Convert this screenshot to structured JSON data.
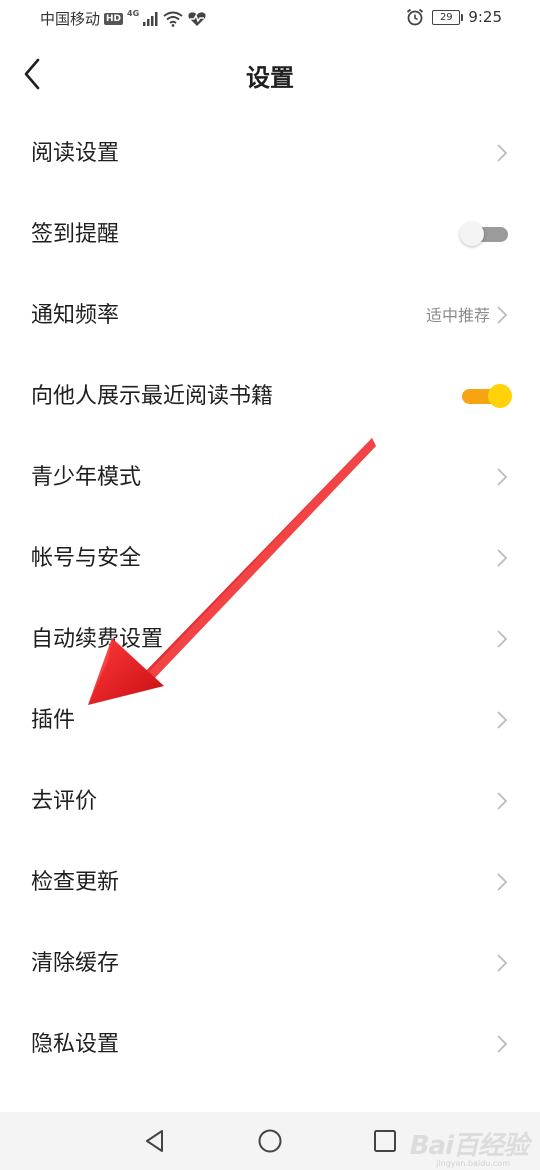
{
  "status_bar": {
    "carrier": "中国移动",
    "hd": "HD",
    "network": "4G",
    "battery": "29",
    "time": "9:25"
  },
  "header": {
    "title": "设置"
  },
  "settings": [
    {
      "label": "阅读设置"
    },
    {
      "label": "签到提醒"
    },
    {
      "label": "通知频率",
      "value": "适中推荐"
    },
    {
      "label": "向他人展示最近阅读书籍"
    },
    {
      "label": "青少年模式"
    },
    {
      "label": "帐号与安全"
    },
    {
      "label": "自动续费设置"
    },
    {
      "label": "插件"
    },
    {
      "label": "去评价"
    },
    {
      "label": "检查更新"
    },
    {
      "label": "清除缓存"
    },
    {
      "label": "隐私设置"
    }
  ],
  "toggles": {
    "signin_reminder": "off",
    "show_recent_books": "on"
  },
  "watermark": {
    "text": "Bai百经验",
    "sub": "jingyan.baidu.com"
  },
  "colors": {
    "accent": "#f6a413",
    "knob_on": "#ffd20a",
    "arrow": "#e8141c"
  }
}
